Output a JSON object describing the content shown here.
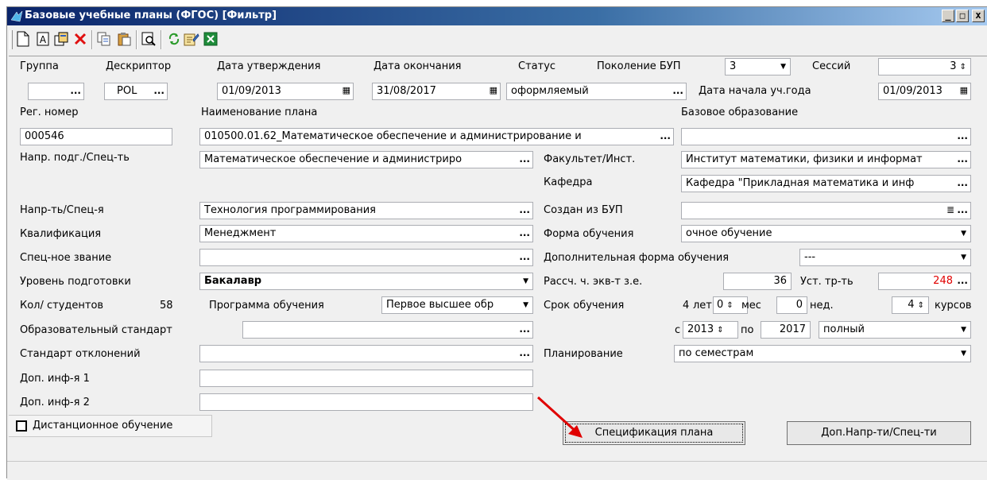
{
  "window": {
    "title": "Базовые учебные планы (ФГОС) [Фильтр]",
    "controls": [
      "_",
      "□",
      "x"
    ]
  },
  "toolbar": {
    "icons": [
      "new-document-icon",
      "text-a-icon",
      "copy-record-icon",
      "delete-icon",
      "copy-icon",
      "paste-icon",
      "preview-icon",
      "refresh-icon",
      "edit-properties-icon",
      "excel-icon"
    ]
  },
  "row1": {
    "group_label": "Группа",
    "group_value": "",
    "descriptor_label": "Дескриптор",
    "descriptor_value": "POL",
    "approval_label": "Дата утверждения",
    "approval_value": "01/09/2013",
    "end_label": "Дата окончания",
    "end_value": "31/08/2017",
    "status_label": "Статус",
    "status_value": "оформляемый",
    "generation_label": "Поколение БУП",
    "generation_value": "3",
    "sessions_label": "Сессий",
    "sessions_value": "3",
    "year_start_label": "Дата начала уч.года",
    "year_start_value": "01/09/2013"
  },
  "row2": {
    "reg_label": "Рег. номер",
    "reg_value": "000546",
    "plan_name_label": "Наименование плана",
    "plan_name_value": "010500.01.62_Математическое обеспечение и администрирование и",
    "base_edu_label": "Базовое образование",
    "base_edu_value": ""
  },
  "left": {
    "direction_label": "Напр. подг./Спец-ть",
    "direction_value": "Математическое обеспечение и администриро",
    "profile_label": "Напр-ть/Спец-я",
    "profile_value": "Технология программирования",
    "qualification_label": "Квалификация",
    "qualification_value": "Менеджмент",
    "special_title_label": "Спец-ное звание",
    "special_title_value": "",
    "level_label": "Уровень подготовки",
    "level_value": "Бакалавр",
    "students_label": "Кол/ студентов",
    "students_value": "58",
    "program_label": "Программа обучения",
    "program_value": "Первое высшее обр",
    "standard_label": "Образовательный стандарт",
    "standard_value": "",
    "deviation_label": "Стандарт отклонений",
    "deviation_value": "",
    "extra1_label": "Доп. инф-я 1",
    "extra1_value": "",
    "extra2_label": "Доп. инф-я 2",
    "extra2_value": ""
  },
  "right": {
    "faculty_label": "Факультет/Инст.",
    "faculty_value": "Институт математики, физики и информат",
    "department_label": "Кафедра",
    "department_value": "Кафедра \"Прикладная математика и инф",
    "created_from_label": "Создан из БУП",
    "created_from_value": "",
    "form_label": "Форма обучения",
    "form_value": "очное обучение",
    "extra_form_label": "Дополнительная форма обучения",
    "extra_form_value": "---",
    "calc_label": "Рассч. ч. экв-т з.е.",
    "calc_value": "36",
    "req_label": "Уст. тр-ть",
    "req_value": "248",
    "duration_label": "Срок обучения",
    "years_value": "4",
    "years_label": "лет",
    "months_value": "0",
    "months_label": "мес",
    "weeks_value": "0",
    "weeks_label": "нед.",
    "courses_value": "4",
    "courses_label": "курсов",
    "from_label": "с",
    "from_value": "2013",
    "to_label": "по",
    "to_value": "2017",
    "period_value": "полный",
    "planning_label": "Планирование",
    "planning_value": "по семестрам"
  },
  "buttons": {
    "spec": "Спецификация плана",
    "extra_dirs": "Доп.Напр-ти/Спец-ти"
  },
  "distance": {
    "label": "Дистанционное обучение",
    "checked": false
  },
  "colors": {
    "titlebar": "#0a246a",
    "warning_value": "#e00000",
    "arrow": "#e00000"
  }
}
